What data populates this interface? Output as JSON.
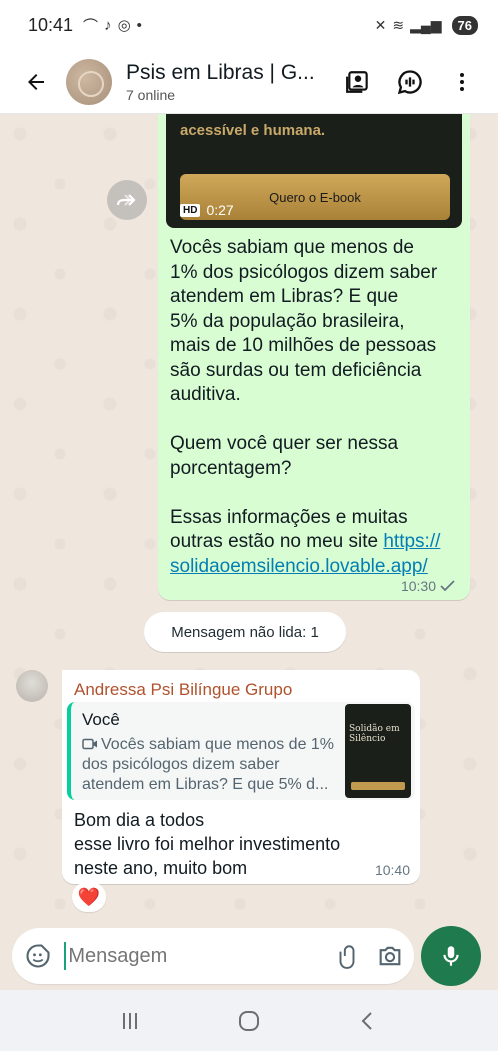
{
  "status_bar": {
    "time": "10:41",
    "battery": "76"
  },
  "header": {
    "title": "Psis em Libras | G...",
    "subtitle": "7 online"
  },
  "outgoing": {
    "video_caption": "acessível e humana.",
    "video_button": "Quero o E-book",
    "video_quality": "HD",
    "video_duration": "0:27",
    "text": "Vocês sabiam que menos de\n1% dos psicólogos dizem saber\natendem em Libras? E que\n5% da população brasileira,\nmais de 10 milhões de pessoas\nsão surdas ou tem deficiência\nauditiva.\n\nQuem você quer ser nessa\nporcentagem?\n\nEssas informações e muitas\noutras estão no meu site ",
    "link": "https://\nsolidaoemsilencio.lovable.app/",
    "time": "10:30",
    "status": "read"
  },
  "unread_label": "Mensagem não lida: 1",
  "incoming": {
    "sender": "Andressa Psi Bilíngue Grupo",
    "quote_author": "Você",
    "quote_text": "Vocês sabiam que menos de 1% dos psicólogos dizem saber atendem em Libras? E que 5% d...",
    "quote_thumb_title": "Solidão em Silêncio",
    "text": "Bom dia a todos\nesse livro foi melhor investimento\nneste ano, muito bom",
    "time": "10:40",
    "reaction": "❤️"
  },
  "composer": {
    "placeholder": "Mensagem"
  },
  "colors": {
    "outgoing_bubble": "#d9fdd3",
    "incoming_bubble": "#ffffff",
    "chat_bg": "#efe7de",
    "accent_green": "#1f7a4d",
    "link": "#027eb5",
    "sender_name": "#b0522d"
  },
  "icons": {
    "back": "back-arrow-icon",
    "contact_card": "contact-card-icon",
    "voice_chat": "voice-chat-icon",
    "menu": "more-vertical-icon",
    "forward": "forward-icon",
    "video": "video-icon",
    "emoji": "sticker-icon",
    "attach": "paperclip-icon",
    "camera": "camera-icon",
    "mic": "mic-icon"
  }
}
